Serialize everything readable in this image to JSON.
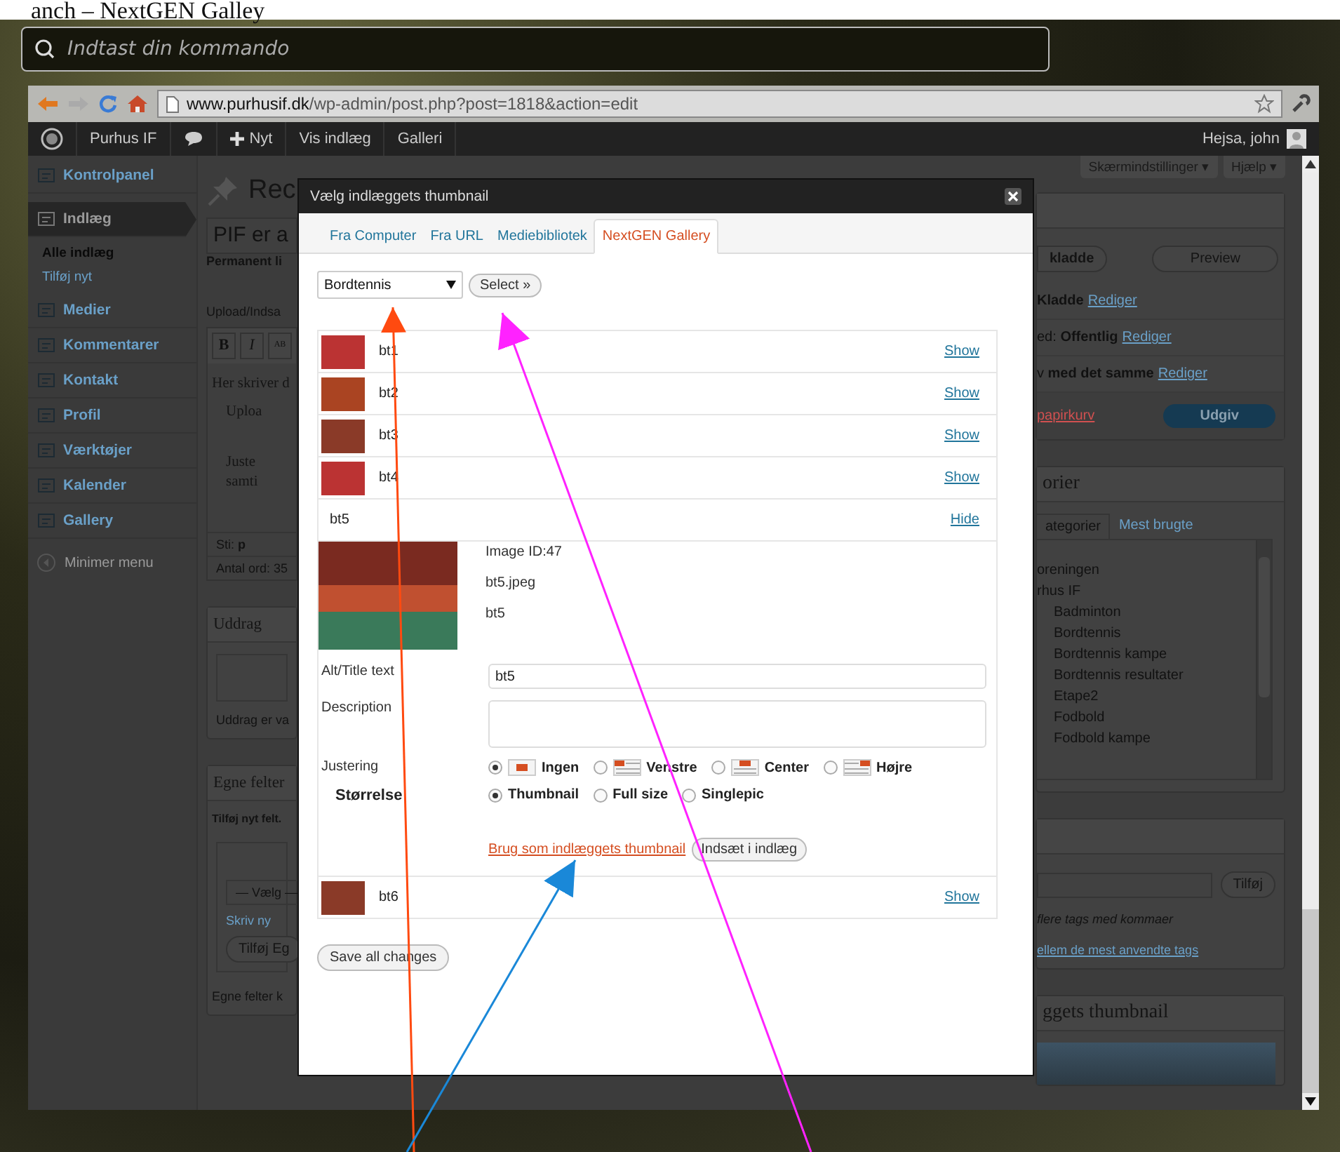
{
  "page_title_fragment": "anch – NextGEN Galley",
  "command_bar": {
    "placeholder": "Indtast din kommando"
  },
  "browser": {
    "url_host": "www.purhusif.dk",
    "url_path": "/wp-admin/post.php?post=1818&action=edit"
  },
  "admin_bar": {
    "items": [
      {
        "kind": "logo"
      },
      {
        "kind": "text",
        "label": "Purhus IF"
      },
      {
        "kind": "comments"
      },
      {
        "kind": "new",
        "label": "Nyt"
      },
      {
        "kind": "text",
        "label": "Vis indlæg"
      },
      {
        "kind": "text",
        "label": "Galleri"
      }
    ],
    "greeting": "Hejsa, john"
  },
  "sidebar": {
    "items": [
      {
        "label": "Kontrolpanel",
        "selected": false
      },
      {
        "label": "Indlæg",
        "selected": true,
        "children": [
          {
            "label": "Alle indlæg",
            "selected": true
          },
          {
            "label": "Tilføj nyt",
            "selected": false
          }
        ]
      },
      {
        "label": "Medier",
        "selected": false
      },
      {
        "label": "Kommentarer",
        "selected": false
      },
      {
        "label": "Kontakt",
        "selected": false
      },
      {
        "label": "Profil",
        "selected": false
      },
      {
        "label": "Værktøjer",
        "selected": false
      },
      {
        "label": "Kalender",
        "selected": false
      },
      {
        "label": "Gallery",
        "selected": false
      }
    ],
    "collapse": "Minimer menu"
  },
  "editor": {
    "heading": "Rec",
    "title_value": "PIF er a",
    "permalink": "Permanent li",
    "upload_label": "Upload/Indsa",
    "toolbar": [
      "B",
      "I",
      "AB"
    ],
    "body": "Her skriver d",
    "bullets": [
      [
        "Uploa"
      ],
      [
        "Juste",
        "samti"
      ]
    ],
    "path_label": "Sti:",
    "path_value": "p",
    "word_count": "Antal ord: 35"
  },
  "excerpt": {
    "title": "Uddrag",
    "note": "Uddrag er va"
  },
  "custom_fields": {
    "title": "Egne felter",
    "add_label": "Tilføj nyt felt.",
    "select": "— Vælg —",
    "link": "Skriv ny",
    "button": "Tilføj Eg",
    "note": "Egne felter k"
  },
  "screen_options": [
    "Skærmindstillinger ▾",
    "Hjælp ▾"
  ],
  "publish": {
    "draft_button": "kladde",
    "preview_button": "Preview",
    "status": [
      {
        "text": "**Kladde**",
        "link": "Rediger"
      },
      {
        "text": "ed: **Offentlig**",
        "link": "Rediger"
      },
      {
        "text": "v **med det samme**",
        "link": "Rediger"
      }
    ],
    "trash": "papirkurv",
    "publish_button": "Udgiv"
  },
  "categories": {
    "title": "orier",
    "tabs": [
      {
        "label": "ategorier",
        "selected": true
      },
      {
        "label": "Mest brugte",
        "selected": false
      }
    ],
    "items": [
      {
        "label": "oreningen"
      },
      {
        "label": "rhus IF",
        "children": [
          {
            "label": "Badminton"
          },
          {
            "label": "Bordtennis"
          },
          {
            "label": "Bordtennis kampe"
          },
          {
            "label": "Bordtennis resultater"
          },
          {
            "label": "Etape2"
          },
          {
            "label": "Fodbold"
          },
          {
            "label": "Fodbold kampe"
          }
        ]
      }
    ]
  },
  "tags": {
    "button": "Tilføj",
    "hint": "flere tags med kommaer",
    "link": "ellem de mest anvendte tags"
  },
  "featured": {
    "title": "ggets thumbnail"
  },
  "modal": {
    "title": "Vælg indlæggets thumbnail",
    "tabs": [
      {
        "label": "Fra Computer",
        "selected": false
      },
      {
        "label": "Fra URL",
        "selected": false
      },
      {
        "label": "Mediebibliotek",
        "selected": false
      },
      {
        "label": "NextGEN Gallery",
        "selected": true
      }
    ],
    "gallery_select": "Bordtennis",
    "select_button": "Select »",
    "images": [
      {
        "name": "bt1",
        "expanded": false,
        "toggle": "Show"
      },
      {
        "name": "bt2",
        "expanded": false,
        "toggle": "Show"
      },
      {
        "name": "bt3",
        "expanded": false,
        "toggle": "Show"
      },
      {
        "name": "bt4",
        "expanded": false,
        "toggle": "Show"
      },
      {
        "name": "bt5",
        "expanded": true,
        "toggle": "Hide",
        "details": {
          "id": "Image ID:47",
          "file": "bt5.jpeg",
          "title": "bt5",
          "alt_label": "Alt/Title text",
          "alt_value": "bt5",
          "description_label": "Description",
          "align_label": "Justering",
          "align_options": [
            {
              "label": "Ingen",
              "kind": "none",
              "selected": true
            },
            {
              "label": "Venstre",
              "kind": "left",
              "selected": false
            },
            {
              "label": "Center",
              "kind": "center",
              "selected": false
            },
            {
              "label": "Højre",
              "kind": "right",
              "selected": false
            }
          ],
          "size_label": "Størrelse",
          "size_options": [
            {
              "label": "Thumbnail",
              "selected": true
            },
            {
              "label": "Full size",
              "selected": false
            },
            {
              "label": "Singlepic",
              "selected": false
            }
          ],
          "thumbnail_link": "Brug som indlæggets thumbnail",
          "insert_button": "Indsæt i indlæg"
        }
      },
      {
        "name": "bt6",
        "expanded": false,
        "toggle": "Show"
      }
    ],
    "save_button": "Save all changes"
  }
}
